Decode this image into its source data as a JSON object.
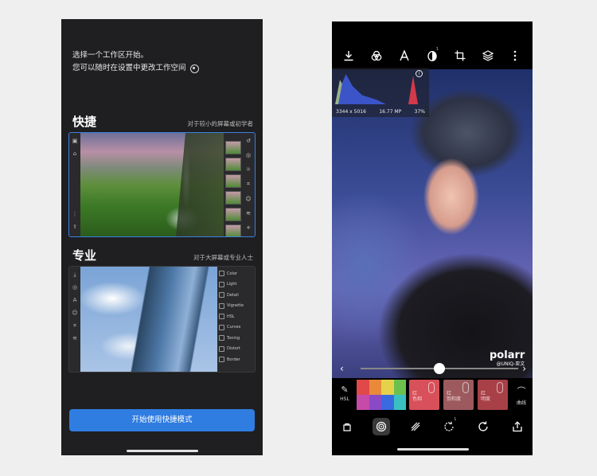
{
  "left": {
    "intro": {
      "line1": "选择一个工作区开始。",
      "line2": "您可以随时在设置中更改工作空间"
    },
    "quick": {
      "title": "快捷",
      "subtitle": "对于较小的屏幕或初学者"
    },
    "pro": {
      "title": "专业",
      "subtitle": "对于大屏幕或专业人士",
      "panel": [
        "Color",
        "Light",
        "Detail",
        "Vignette",
        "HSL",
        "Curves",
        "Toning",
        "Distort",
        "Border"
      ]
    },
    "start_button": "开始使用快捷模式"
  },
  "right": {
    "histogram": {
      "dimensions": "3344 x 5016",
      "megapixels": "16.77 MP",
      "zoom": "37%"
    },
    "watermark": {
      "brand": "polarr",
      "sub": "@UNIQ-亚文"
    },
    "slider": {
      "value": 0.5
    },
    "hsl": {
      "tool_label": "HSL",
      "colors": [
        "#e0484a",
        "#e88a3a",
        "#e6d24a",
        "#6cc04e",
        "#c64aa8",
        "#8a4ac8",
        "#3a6ae0",
        "#3ac0c0"
      ],
      "swatches": [
        {
          "line1": "红",
          "line2": "色相",
          "color": "#d8505a"
        },
        {
          "line1": "红",
          "line2": "饱和度",
          "color": "#9c5a5e"
        },
        {
          "line1": "红",
          "line2": "明度",
          "color": "#a84048"
        }
      ],
      "curve_label": "曲线"
    },
    "top_badge": "1",
    "bottom_badge": "1"
  }
}
